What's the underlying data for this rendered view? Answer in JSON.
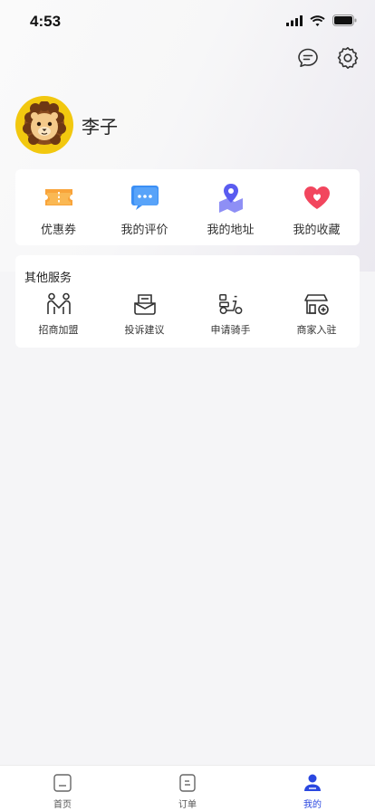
{
  "status_bar": {
    "time": "4:53"
  },
  "profile": {
    "name": "李子"
  },
  "quick_actions": [
    {
      "label": "优惠券",
      "icon": "coupon-icon",
      "color": "#f9a43a"
    },
    {
      "label": "我的评价",
      "icon": "comment-icon",
      "color": "#3b8ff5"
    },
    {
      "label": "我的地址",
      "icon": "location-icon",
      "color": "#5a5cf0"
    },
    {
      "label": "我的收藏",
      "icon": "heart-icon",
      "color": "#f2465e"
    }
  ],
  "other_services": {
    "title": "其他服务",
    "items": [
      {
        "label": "招商加盟",
        "icon": "partnership-icon"
      },
      {
        "label": "投诉建议",
        "icon": "feedback-icon"
      },
      {
        "label": "申请骑手",
        "icon": "scooter-icon"
      },
      {
        "label": "商家入驻",
        "icon": "store-add-icon"
      }
    ]
  },
  "tabbar": {
    "active": "我的",
    "tabs": [
      {
        "label": "首页",
        "icon": "home-icon"
      },
      {
        "label": "订单",
        "icon": "order-icon"
      },
      {
        "label": "我的",
        "icon": "profile-icon"
      }
    ]
  },
  "colors": {
    "accent": "#2a47e0",
    "avatar_bg": "#f2c80f"
  }
}
